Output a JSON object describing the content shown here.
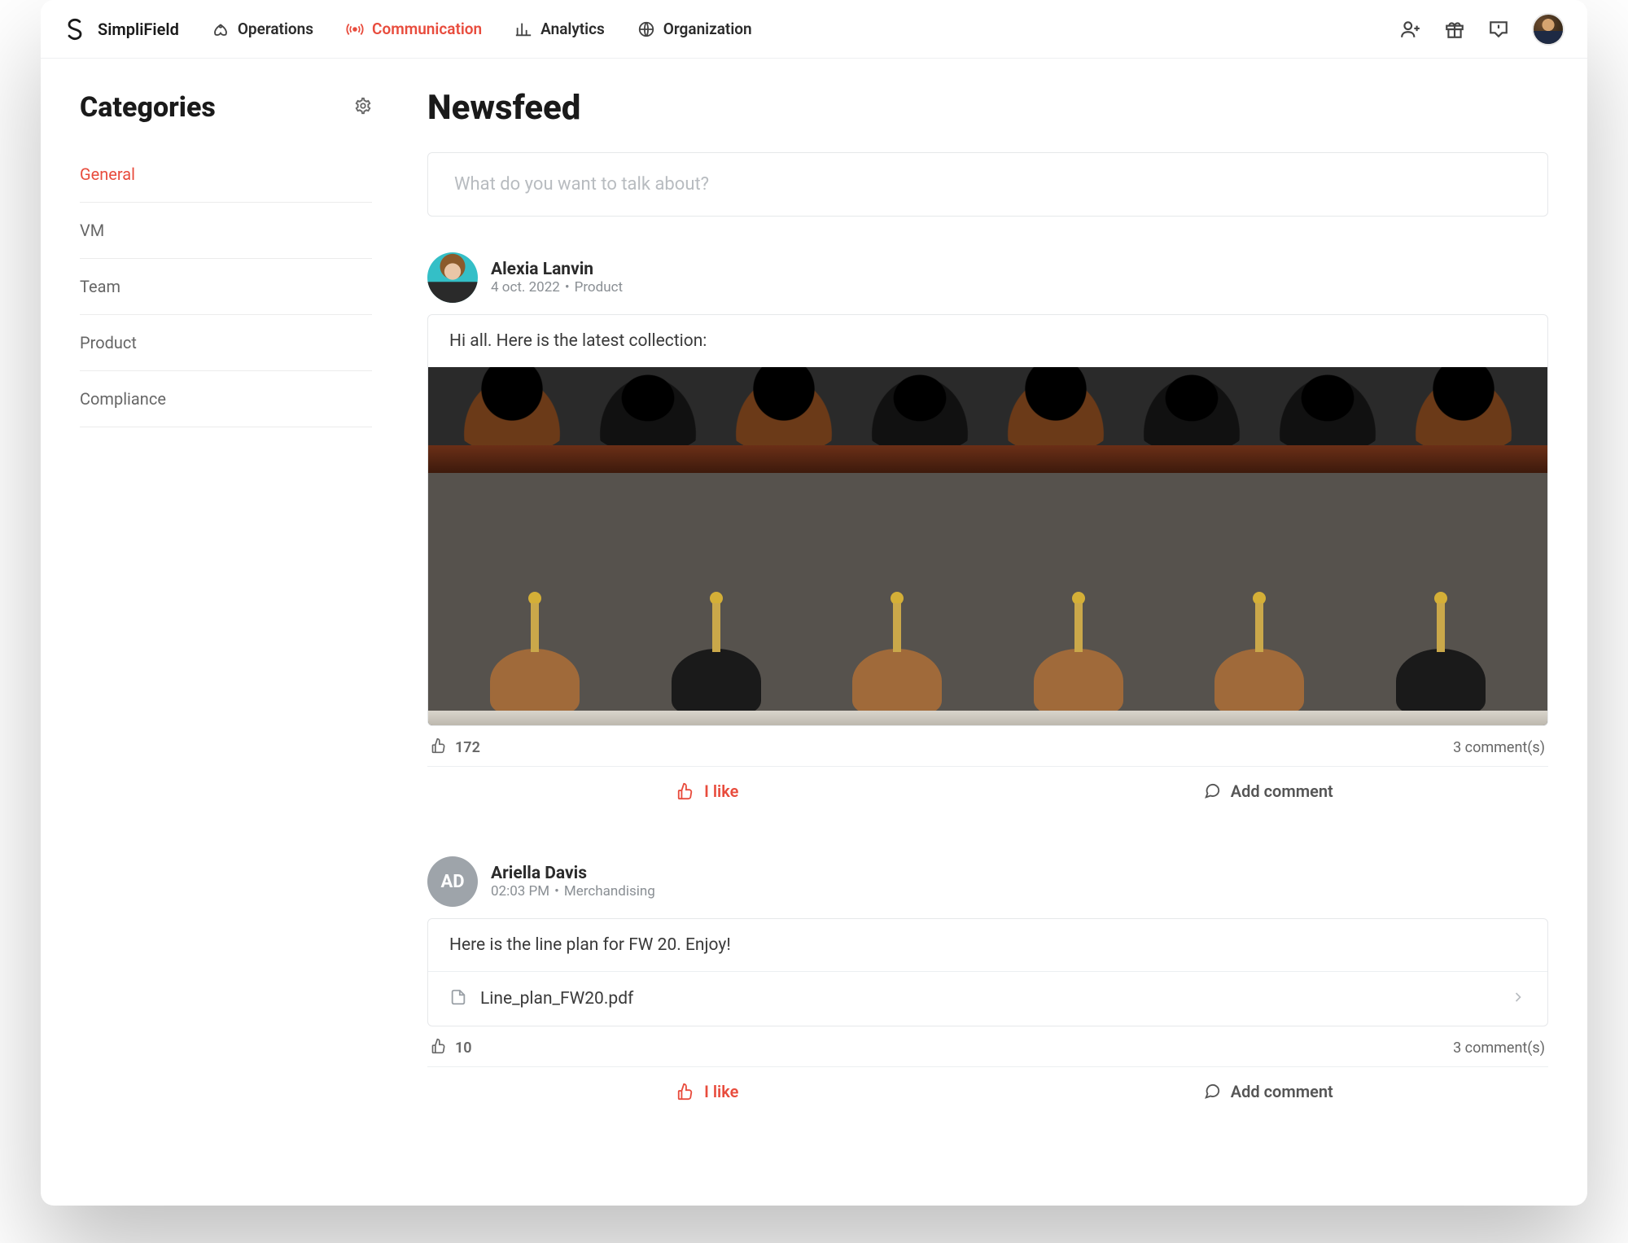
{
  "brand": {
    "name": "SimpliField"
  },
  "nav": [
    {
      "label": "Operations",
      "active": false
    },
    {
      "label": "Communication",
      "active": true
    },
    {
      "label": "Analytics",
      "active": false
    },
    {
      "label": "Organization",
      "active": false
    }
  ],
  "sidebar": {
    "title": "Categories",
    "items": [
      {
        "label": "General",
        "active": true
      },
      {
        "label": "VM",
        "active": false
      },
      {
        "label": "Team",
        "active": false
      },
      {
        "label": "Product",
        "active": false
      },
      {
        "label": "Compliance",
        "active": false
      }
    ]
  },
  "main": {
    "title": "Newsfeed",
    "composer_placeholder": "What do you want to talk about?"
  },
  "posts": [
    {
      "author": "Alexia Lanvin",
      "avatar_initials": "",
      "avatar_style": "teal",
      "date": "4 oct. 2022",
      "category": "Product",
      "text": "Hi all. Here is the latest collection:",
      "has_image": true,
      "likes": 172,
      "comments_label": "3 comment(s)",
      "like_label": "I like",
      "add_comment_label": "Add comment"
    },
    {
      "author": "Ariella Davis",
      "avatar_initials": "AD",
      "avatar_style": "grey",
      "date": "02:03 PM",
      "category": "Merchandising",
      "text": "Here is the line plan for FW 20. Enjoy!",
      "file_name": "Line_plan_FW20.pdf",
      "likes": 10,
      "comments_label": "3 comment(s)",
      "like_label": "I like",
      "add_comment_label": "Add comment"
    }
  ]
}
